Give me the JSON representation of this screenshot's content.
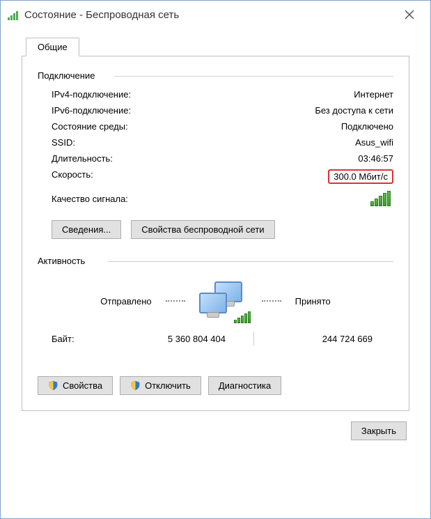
{
  "window": {
    "title": "Состояние - Беспроводная сеть"
  },
  "tab": {
    "general": "Общие"
  },
  "connection": {
    "group_label": "Подключение",
    "ipv4_label": "IPv4-подключение:",
    "ipv4_value": "Интернет",
    "ipv6_label": "IPv6-подключение:",
    "ipv6_value": "Без доступа к сети",
    "media_label": "Состояние среды:",
    "media_value": "Подключено",
    "ssid_label": "SSID:",
    "ssid_value": "Asus_wifi",
    "duration_label": "Длительность:",
    "duration_value": "03:46:57",
    "speed_label": "Скорость:",
    "speed_value": "300.0 Мбит/с",
    "signal_label": "Качество сигнала:"
  },
  "buttons": {
    "details": "Сведения...",
    "wireless_props": "Свойства беспроводной сети",
    "properties": "Свойства",
    "disable": "Отключить",
    "diagnose": "Диагностика",
    "close": "Закрыть"
  },
  "activity": {
    "group_label": "Активность",
    "sent_label": "Отправлено",
    "received_label": "Принято",
    "bytes_label": "Байт:",
    "bytes_sent": "5 360 804 404",
    "bytes_received": "244 724 669"
  }
}
